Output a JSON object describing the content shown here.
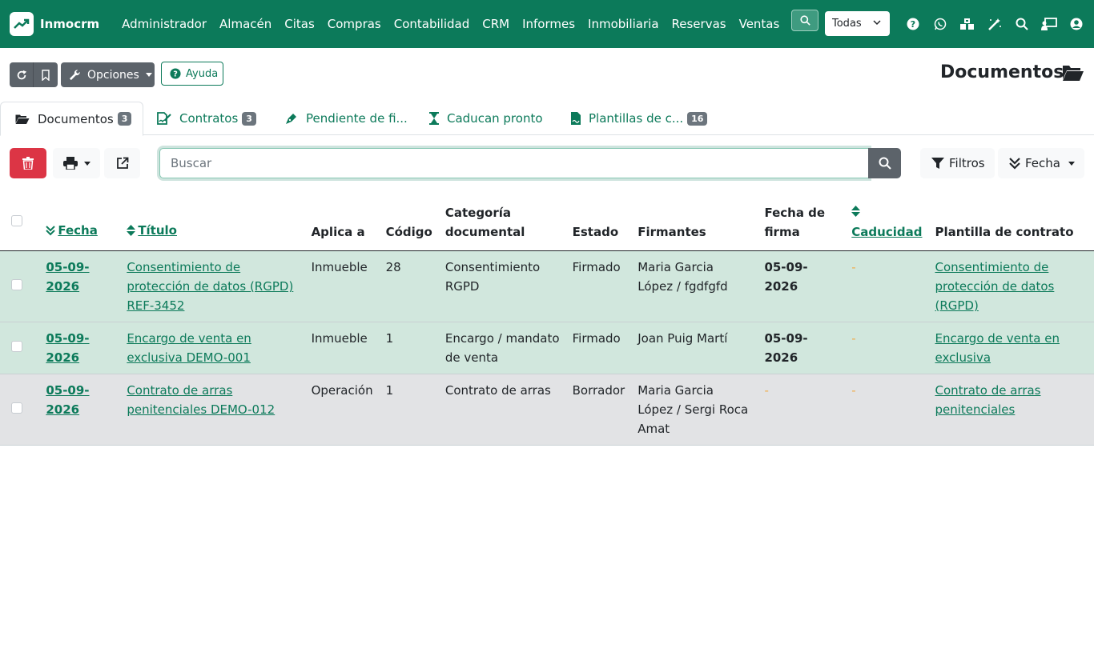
{
  "brand": {
    "name": "Inmocrm"
  },
  "menu": [
    "Administrador",
    "Almacén",
    "Citas",
    "Compras",
    "Contabilidad",
    "CRM",
    "Informes",
    "Inmobiliaria",
    "Reservas",
    "Ventas"
  ],
  "nav": {
    "company_select": "Todas"
  },
  "toolbar": {
    "options_label": "Opciones",
    "help_label": "Ayuda",
    "page_title": "Documentos"
  },
  "tabs": [
    {
      "label": "Documentos",
      "badge": "3"
    },
    {
      "label": "Contratos",
      "badge": "3"
    },
    {
      "label": "Pendiente de fi..."
    },
    {
      "label": "Caducan pronto"
    },
    {
      "label": "Plantillas de c...",
      "badge": "16"
    }
  ],
  "search": {
    "placeholder": "Buscar"
  },
  "actions": {
    "filters_label": "Filtros",
    "date_label": "Fecha"
  },
  "table": {
    "headers": [
      "Fecha",
      "Título",
      "Aplica a",
      "Código",
      "Categoría documental",
      "Estado",
      "Firmantes",
      "Fecha de firma",
      "Caducidad",
      "Plantilla de contrato"
    ],
    "rows": [
      {
        "fecha": "05-09-2026",
        "titulo": "Consentimiento de protección de datos (RGPD) REF-3452",
        "aplica": "Inmueble",
        "codigo": "28",
        "categoria": "Consentimiento RGPD",
        "estado": "Firmado",
        "firmantes": "Maria Garcia López / fgdfgfd",
        "fecha_firma": "05-09-2026",
        "caducidad": "-",
        "plantilla": "Consentimiento de protección de datos (RGPD)"
      },
      {
        "fecha": "05-09-2026",
        "titulo": "Encargo de venta en exclusiva DEMO-001",
        "aplica": "Inmueble",
        "codigo": "1",
        "categoria": "Encargo / mandato de venta",
        "estado": "Firmado",
        "firmantes": "Joan Puig Martí",
        "fecha_firma": "05-09-2026",
        "caducidad": "-",
        "plantilla": "Encargo de venta en exclusiva"
      },
      {
        "fecha": "05-09-2026",
        "titulo": "Contrato de arras penitenciales DEMO-012",
        "aplica": "Operación",
        "codigo": "1",
        "categoria": "Contrato de arras",
        "estado": "Borrador",
        "firmantes": "Maria Garcia López / Sergi Roca Amat",
        "fecha_firma": "-",
        "caducidad": "-",
        "plantilla": "Contrato de arras penitenciales"
      }
    ]
  },
  "colors": {
    "brand": "#0c7a5a",
    "danger": "#dc3545",
    "row_success": "#d1e7dd",
    "row_secondary": "#e2e3e5"
  }
}
